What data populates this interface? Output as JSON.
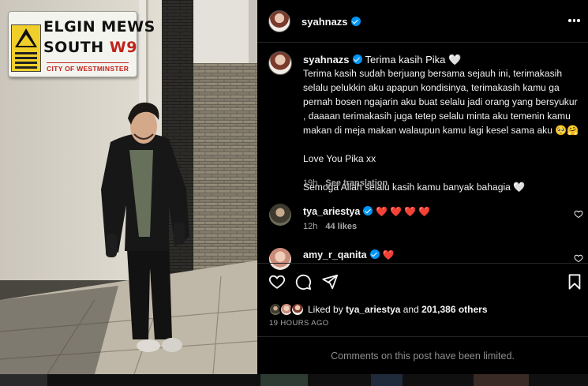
{
  "photo": {
    "sign_line1": "ELGIN MEWS",
    "sign_line2": "SOUTH",
    "sign_code": "W9",
    "sign_line3": "CITY OF WESTMINSTER"
  },
  "post": {
    "author": "syahnazs",
    "verified": true,
    "more_icon": "more-horizontal-icon"
  },
  "caption": {
    "author": "syahnazs",
    "title": "Terima kasih Pika 🤍",
    "paragraphs": [
      "Terima kasih sudah berjuang bersama sejauh ini, terimakasih\nselalu pelukkin aku apapun kondisinya, terimakasih kamu ga\npernah bosen ngajarin aku buat selalu jadi orang yang bersyukur\n, daaaan terimakasih juga tetep selalu minta aku temenin kamu\nmakan di meja makan walaupun kamu lagi kesel sama aku 🥺🤗",
      "Love You Pika xx",
      "Semoga Allah selalu kasih kamu banyak bahagia 🤍"
    ],
    "time": "19h",
    "translate": "See translation"
  },
  "comments": [
    {
      "user": "tya_ariestya",
      "text": "❤️❤️❤️❤️",
      "time": "12h",
      "likes": "44 likes"
    },
    {
      "user": "amy_r_qanita",
      "text": "❤️"
    }
  ],
  "actions": {
    "like_icon": "heart-icon",
    "comment_icon": "comment-icon",
    "share_icon": "send-icon",
    "save_icon": "bookmark-icon"
  },
  "likes": {
    "prefix": "Liked by ",
    "user": "tya_ariestya",
    "middle": " and ",
    "count": "201,386 others"
  },
  "timestamp": "19 HOURS AGO",
  "comments_limited": "Comments on this post have been limited.",
  "colors": {
    "background": "#000000",
    "verified": "#0095f6",
    "heart": "#ed4956",
    "secondary_text": "#a8a8a8"
  }
}
